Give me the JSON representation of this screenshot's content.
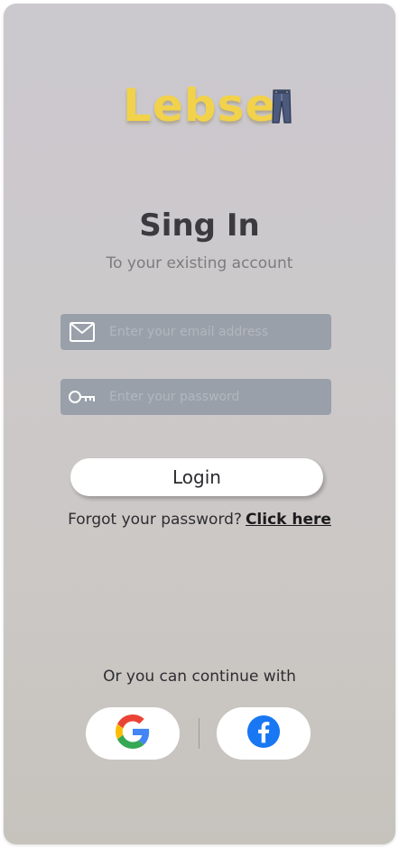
{
  "brand": {
    "logo_text": "Lebse",
    "logo_icon": "jeans-icon"
  },
  "header": {
    "title": "Sing In",
    "subtitle": "To your existing account"
  },
  "form": {
    "email": {
      "placeholder": "Enter your email address",
      "value": "",
      "icon": "mail-icon"
    },
    "password": {
      "placeholder": "Enter your password",
      "value": "",
      "icon": "key-icon"
    },
    "login_label": "Login",
    "forgot_text": "Forgot your password?",
    "forgot_link": "Click here"
  },
  "social": {
    "continue_text": "Or you can continue with",
    "providers": [
      {
        "name": "google",
        "icon": "google-icon"
      },
      {
        "name": "facebook",
        "icon": "facebook-icon"
      }
    ]
  },
  "colors": {
    "logo": "#f1d24a",
    "field_bg": "#9aa0aa",
    "facebook": "#1877f2"
  }
}
